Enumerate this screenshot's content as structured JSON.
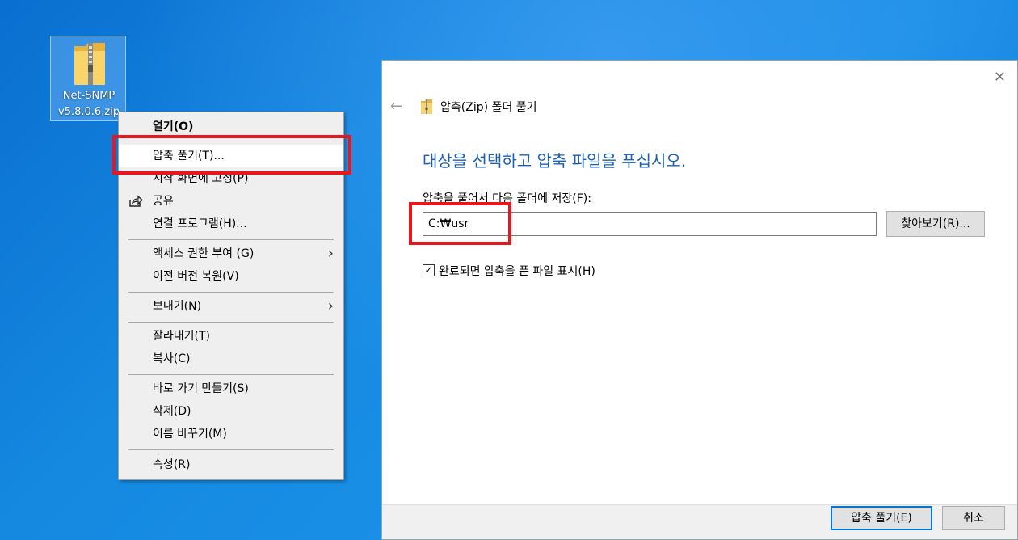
{
  "desktop": {
    "icon_label_line1": "Net-SNMP",
    "icon_label_line2": "v5.8.0.6.zip",
    "icon": "zip-folder-icon"
  },
  "context_menu": {
    "items": [
      {
        "label": "열기(O)",
        "bold": true
      },
      {
        "label": "압축 풀기(T)...",
        "highlighted": true
      },
      {
        "label": "시작 화면에 고정(P)"
      },
      {
        "label": "공유",
        "icon": "share-icon"
      },
      {
        "label": "연결 프로그램(H)..."
      },
      {
        "label": "액세스 권한 부여 (G)",
        "submenu": true
      },
      {
        "label": "이전 버전 복원(V)"
      },
      {
        "label": "보내기(N)",
        "submenu": true
      },
      {
        "label": "잘라내기(T)"
      },
      {
        "label": "복사(C)"
      },
      {
        "label": "바로 가기 만들기(S)"
      },
      {
        "label": "삭제(D)"
      },
      {
        "label": "이름 바꾸기(M)"
      },
      {
        "label": "속성(R)"
      }
    ]
  },
  "dialog": {
    "title": "압축(Zip) 폴더 풀기",
    "heading": "대상을 선택하고 압축 파일을 푸십시오.",
    "field_label": "압축을 풀어서 다음 폴더에 저장(F):",
    "path_value": "C:₩usr",
    "browse_label": "찾아보기(R)...",
    "checkbox_label": "완료되면 압축을 푼 파일 표시(H)",
    "checkbox_checked": true,
    "ok_label": "압축 풀기(E)",
    "cancel_label": "취소",
    "close_glyph": "✕",
    "back_glyph": "←"
  },
  "colors": {
    "highlight_box": "#e8161e",
    "heading_blue": "#1a5fb4",
    "default_button_border": "#0078d7"
  }
}
